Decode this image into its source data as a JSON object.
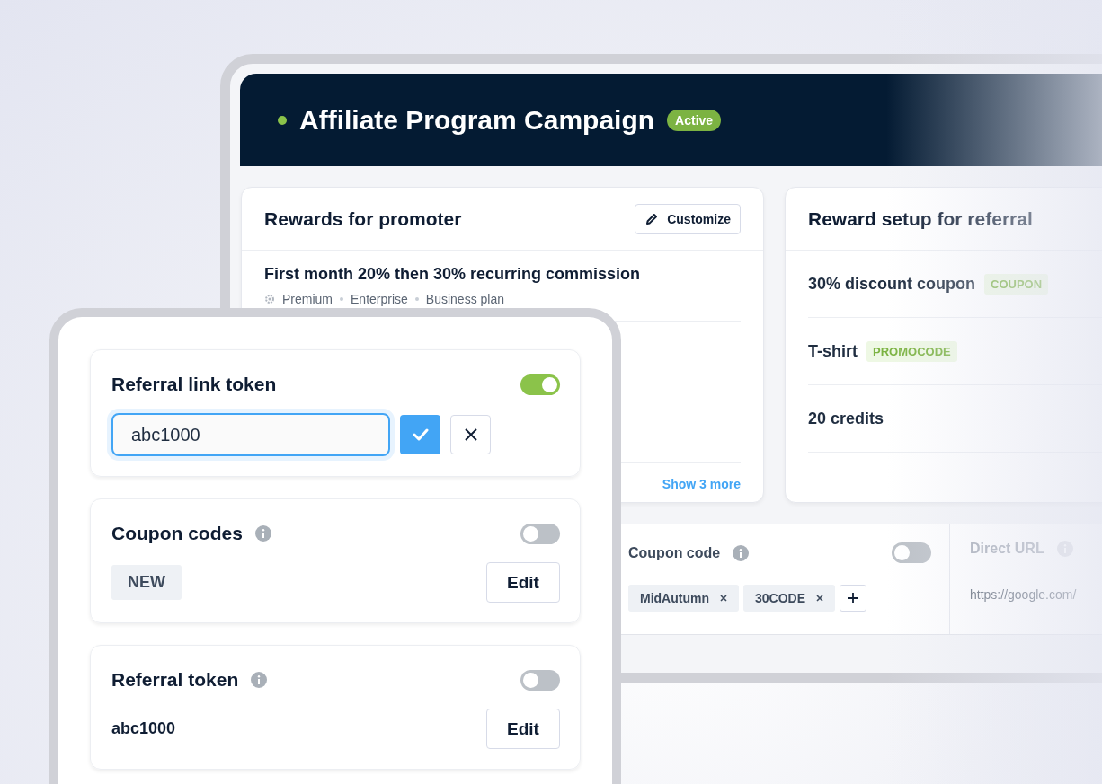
{
  "campaign": {
    "title": "Affiliate Program Campaign",
    "status": "Active",
    "live": true
  },
  "promoter_rewards": {
    "title": "Rewards for promoter",
    "customize_button": "Customize",
    "rewards": [
      {
        "title": "First month 20% then 30% recurring commission",
        "plans": [
          "Premium",
          "Enterprise",
          "Business plan"
        ]
      }
    ],
    "show_more": "Show 3 more"
  },
  "referral_rewards": {
    "title": "Reward setup for referral",
    "rewards": [
      {
        "name": "30% discount coupon",
        "tag": "COUPON"
      },
      {
        "name": "T-shirt",
        "tag": "PROMOCODE"
      },
      {
        "name": "20 credits"
      }
    ]
  },
  "coupon_code": {
    "title": "Coupon code",
    "info": true,
    "on": false,
    "codes": [
      "MidAutumn",
      "30CODE"
    ]
  },
  "direct_url": {
    "title": "Direct URL",
    "info": true,
    "url": "https://google.com/"
  },
  "settings": [
    {
      "kind": "token_input",
      "title": "Referral link token",
      "on": true,
      "value": "abc1000"
    },
    {
      "kind": "codes",
      "title": "Coupon codes",
      "info": true,
      "on": false,
      "tag": "NEW",
      "edit_button": "Edit"
    },
    {
      "kind": "token",
      "title": "Referral token",
      "info": true,
      "on": false,
      "value": "abc1000",
      "edit_button": "Edit"
    }
  ]
}
